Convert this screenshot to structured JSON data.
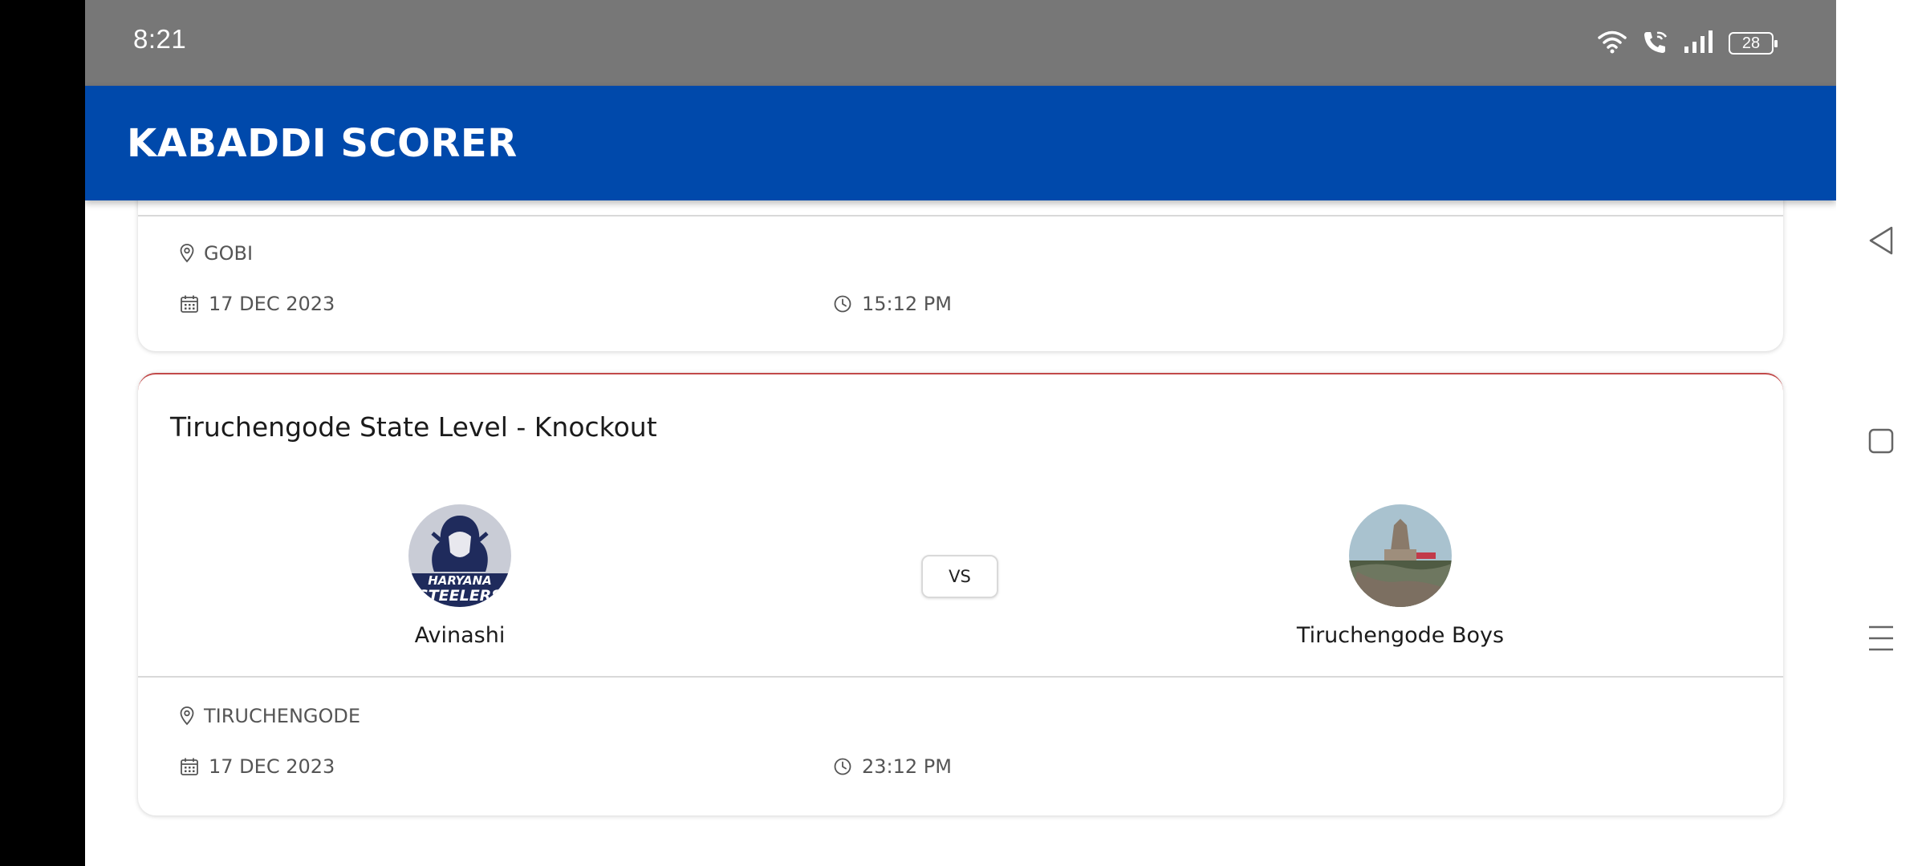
{
  "status_bar": {
    "time": "8:21",
    "battery": "28"
  },
  "app_bar": {
    "title": "KABADDI SCORER"
  },
  "matches": [
    {
      "location": "GOBI",
      "date": "17 DEC 2023",
      "time": "15:12 PM"
    },
    {
      "title": "Tiruchengode State Level - Knockout",
      "team_a": {
        "name": "Avinashi",
        "logo_text": [
          "HARYANA",
          "STEELERS"
        ]
      },
      "vs": "VS",
      "team_b": {
        "name": "Tiruchengode Boys"
      },
      "location": "TIRUCHENGODE",
      "date": "17 DEC 2023",
      "time": "23:12 PM"
    }
  ],
  "colors": {
    "app_bar": "#0049ab",
    "status_bar": "#777777",
    "card_accent": "#c24a4a"
  },
  "nav": {
    "icons": [
      "back-icon",
      "home-icon",
      "menu-icon"
    ]
  }
}
